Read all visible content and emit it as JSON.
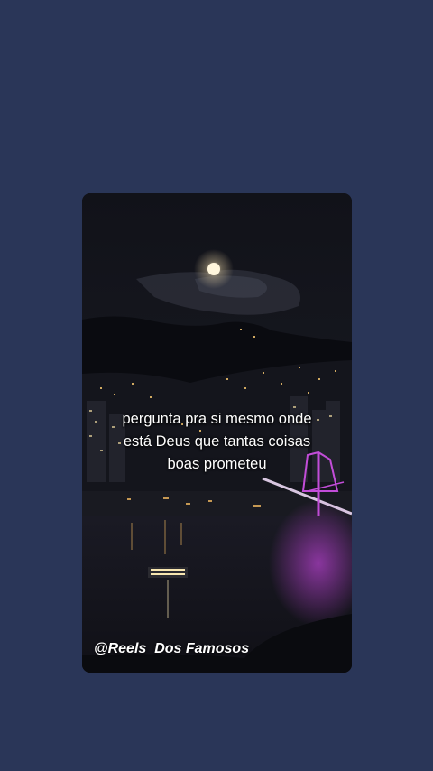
{
  "caption": {
    "line1": "pergunta pra si mesmo onde",
    "line2": "está Deus que tantas coisas",
    "line3": "boas prometeu"
  },
  "watermark": "@Reels  Dos Famosos",
  "colors": {
    "background": "#2a3658",
    "caption_text": "#ffffff",
    "bridge_light": "#c24dd8",
    "city_lights": "#f2c46e",
    "moon": "#fff6dc"
  }
}
